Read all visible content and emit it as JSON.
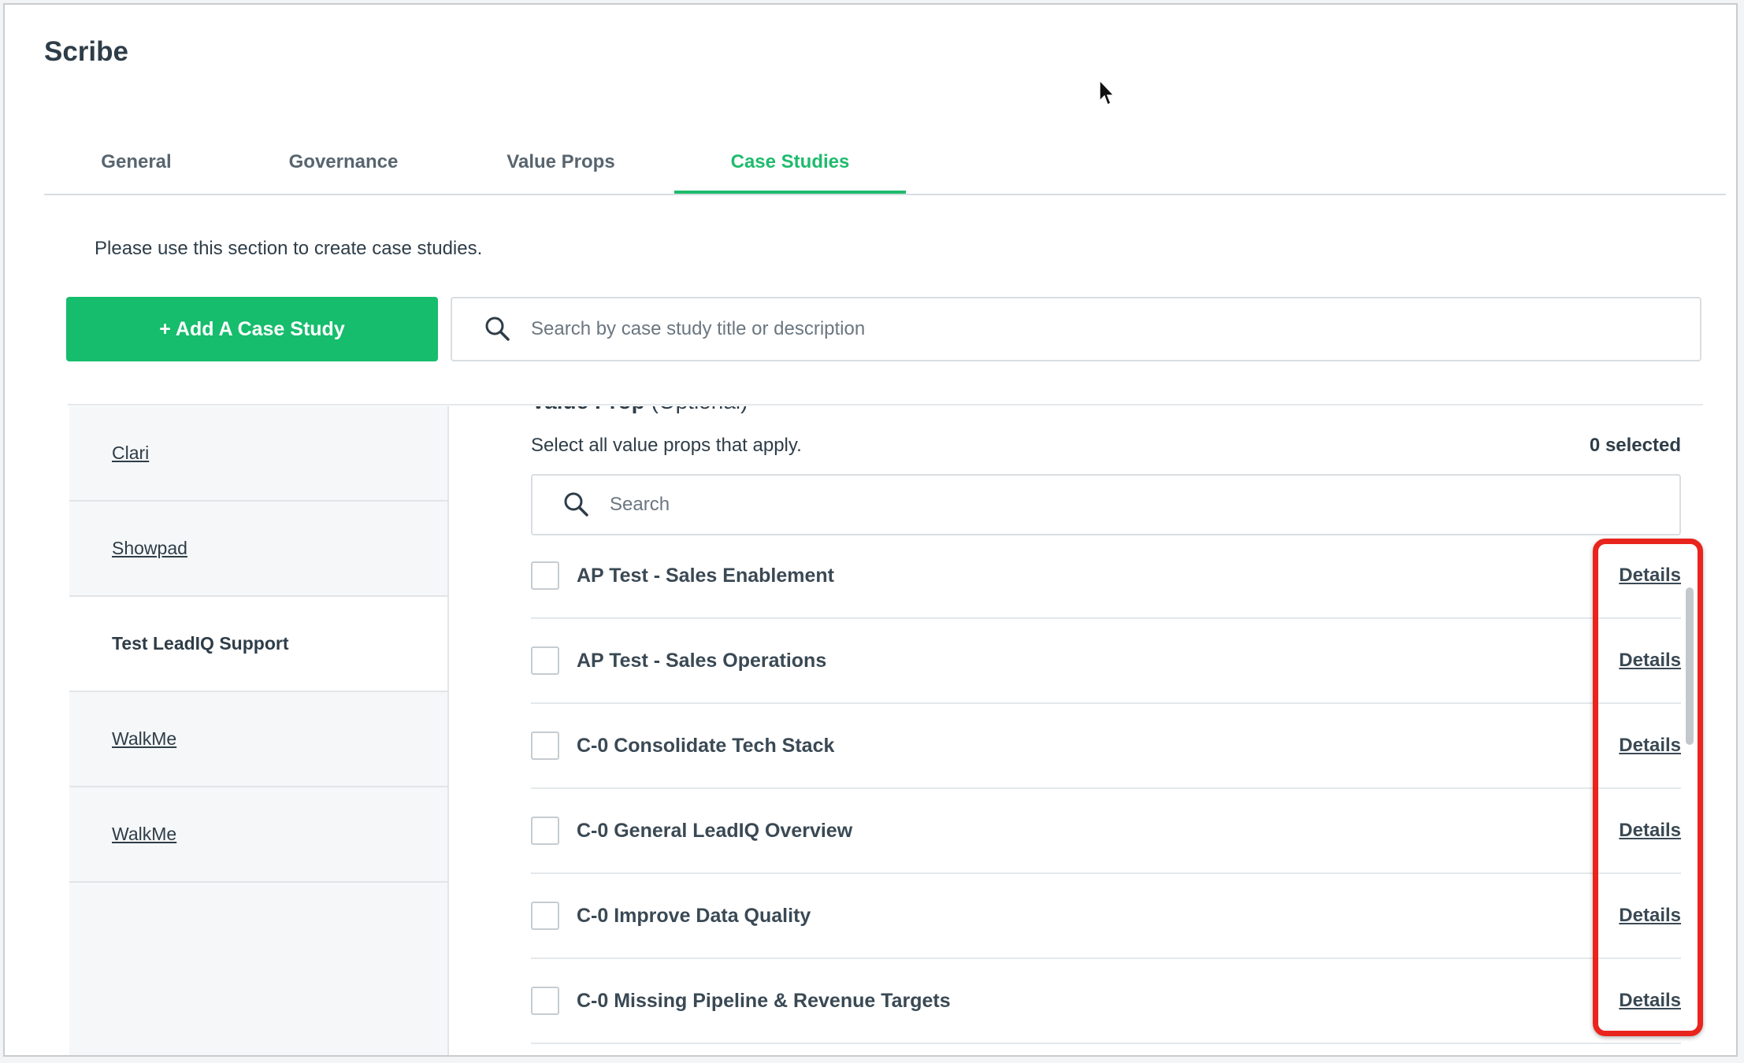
{
  "app": {
    "title": "Scribe"
  },
  "tabs": [
    {
      "label": "General",
      "active": false
    },
    {
      "label": "Governance",
      "active": false
    },
    {
      "label": "Value Props",
      "active": false
    },
    {
      "label": "Case Studies",
      "active": true
    }
  ],
  "intro_text": "Please use this section to create case studies.",
  "toolbar": {
    "add_label": "+ Add A Case Study",
    "search_placeholder": "Search by case study title or description",
    "search_icon": "search-icon"
  },
  "sidebar": {
    "items": [
      {
        "label": "Clari",
        "active": false
      },
      {
        "label": "Showpad",
        "active": false
      },
      {
        "label": "Test LeadIQ Support",
        "active": true
      },
      {
        "label": "WalkMe",
        "active": false
      },
      {
        "label": "WalkMe",
        "active": false
      }
    ]
  },
  "value_props": {
    "heading_bold": "Value Prop",
    "heading_note": "(Optional)",
    "subtitle": "Select all value props that apply.",
    "selected_count": "0 selected",
    "search_placeholder": "Search",
    "details_label": "Details",
    "items": [
      {
        "label": "AP Test - Sales Enablement",
        "checked": false
      },
      {
        "label": "AP Test - Sales Operations",
        "checked": false
      },
      {
        "label": "C-0 Consolidate Tech Stack",
        "checked": false
      },
      {
        "label": "C-0 General LeadIQ Overview",
        "checked": false
      },
      {
        "label": "C-0 Improve Data Quality",
        "checked": false
      },
      {
        "label": "C-0 Missing Pipeline & Revenue Targets",
        "checked": false
      }
    ]
  },
  "colors": {
    "accent": "#16bd6c",
    "text": "#2e3d48",
    "highlight": "#e8241d"
  }
}
